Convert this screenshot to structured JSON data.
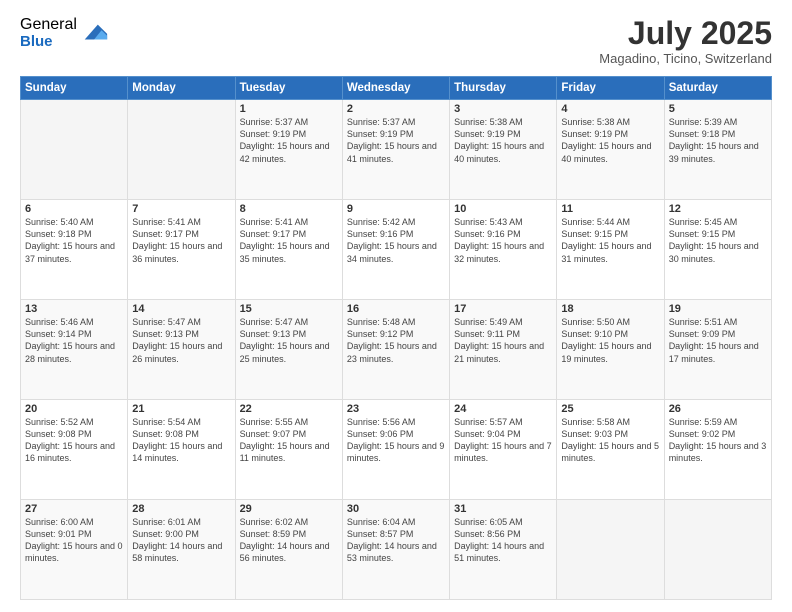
{
  "logo": {
    "general": "General",
    "blue": "Blue"
  },
  "title": "July 2025",
  "subtitle": "Magadino, Ticino, Switzerland",
  "days_of_week": [
    "Sunday",
    "Monday",
    "Tuesday",
    "Wednesday",
    "Thursday",
    "Friday",
    "Saturday"
  ],
  "weeks": [
    [
      {
        "day": "",
        "info": ""
      },
      {
        "day": "",
        "info": ""
      },
      {
        "day": "1",
        "info": "Sunrise: 5:37 AM\nSunset: 9:19 PM\nDaylight: 15 hours and 42 minutes."
      },
      {
        "day": "2",
        "info": "Sunrise: 5:37 AM\nSunset: 9:19 PM\nDaylight: 15 hours and 41 minutes."
      },
      {
        "day": "3",
        "info": "Sunrise: 5:38 AM\nSunset: 9:19 PM\nDaylight: 15 hours and 40 minutes."
      },
      {
        "day": "4",
        "info": "Sunrise: 5:38 AM\nSunset: 9:19 PM\nDaylight: 15 hours and 40 minutes."
      },
      {
        "day": "5",
        "info": "Sunrise: 5:39 AM\nSunset: 9:18 PM\nDaylight: 15 hours and 39 minutes."
      }
    ],
    [
      {
        "day": "6",
        "info": "Sunrise: 5:40 AM\nSunset: 9:18 PM\nDaylight: 15 hours and 37 minutes."
      },
      {
        "day": "7",
        "info": "Sunrise: 5:41 AM\nSunset: 9:17 PM\nDaylight: 15 hours and 36 minutes."
      },
      {
        "day": "8",
        "info": "Sunrise: 5:41 AM\nSunset: 9:17 PM\nDaylight: 15 hours and 35 minutes."
      },
      {
        "day": "9",
        "info": "Sunrise: 5:42 AM\nSunset: 9:16 PM\nDaylight: 15 hours and 34 minutes."
      },
      {
        "day": "10",
        "info": "Sunrise: 5:43 AM\nSunset: 9:16 PM\nDaylight: 15 hours and 32 minutes."
      },
      {
        "day": "11",
        "info": "Sunrise: 5:44 AM\nSunset: 9:15 PM\nDaylight: 15 hours and 31 minutes."
      },
      {
        "day": "12",
        "info": "Sunrise: 5:45 AM\nSunset: 9:15 PM\nDaylight: 15 hours and 30 minutes."
      }
    ],
    [
      {
        "day": "13",
        "info": "Sunrise: 5:46 AM\nSunset: 9:14 PM\nDaylight: 15 hours and 28 minutes."
      },
      {
        "day": "14",
        "info": "Sunrise: 5:47 AM\nSunset: 9:13 PM\nDaylight: 15 hours and 26 minutes."
      },
      {
        "day": "15",
        "info": "Sunrise: 5:47 AM\nSunset: 9:13 PM\nDaylight: 15 hours and 25 minutes."
      },
      {
        "day": "16",
        "info": "Sunrise: 5:48 AM\nSunset: 9:12 PM\nDaylight: 15 hours and 23 minutes."
      },
      {
        "day": "17",
        "info": "Sunrise: 5:49 AM\nSunset: 9:11 PM\nDaylight: 15 hours and 21 minutes."
      },
      {
        "day": "18",
        "info": "Sunrise: 5:50 AM\nSunset: 9:10 PM\nDaylight: 15 hours and 19 minutes."
      },
      {
        "day": "19",
        "info": "Sunrise: 5:51 AM\nSunset: 9:09 PM\nDaylight: 15 hours and 17 minutes."
      }
    ],
    [
      {
        "day": "20",
        "info": "Sunrise: 5:52 AM\nSunset: 9:08 PM\nDaylight: 15 hours and 16 minutes."
      },
      {
        "day": "21",
        "info": "Sunrise: 5:54 AM\nSunset: 9:08 PM\nDaylight: 15 hours and 14 minutes."
      },
      {
        "day": "22",
        "info": "Sunrise: 5:55 AM\nSunset: 9:07 PM\nDaylight: 15 hours and 11 minutes."
      },
      {
        "day": "23",
        "info": "Sunrise: 5:56 AM\nSunset: 9:06 PM\nDaylight: 15 hours and 9 minutes."
      },
      {
        "day": "24",
        "info": "Sunrise: 5:57 AM\nSunset: 9:04 PM\nDaylight: 15 hours and 7 minutes."
      },
      {
        "day": "25",
        "info": "Sunrise: 5:58 AM\nSunset: 9:03 PM\nDaylight: 15 hours and 5 minutes."
      },
      {
        "day": "26",
        "info": "Sunrise: 5:59 AM\nSunset: 9:02 PM\nDaylight: 15 hours and 3 minutes."
      }
    ],
    [
      {
        "day": "27",
        "info": "Sunrise: 6:00 AM\nSunset: 9:01 PM\nDaylight: 15 hours and 0 minutes."
      },
      {
        "day": "28",
        "info": "Sunrise: 6:01 AM\nSunset: 9:00 PM\nDaylight: 14 hours and 58 minutes."
      },
      {
        "day": "29",
        "info": "Sunrise: 6:02 AM\nSunset: 8:59 PM\nDaylight: 14 hours and 56 minutes."
      },
      {
        "day": "30",
        "info": "Sunrise: 6:04 AM\nSunset: 8:57 PM\nDaylight: 14 hours and 53 minutes."
      },
      {
        "day": "31",
        "info": "Sunrise: 6:05 AM\nSunset: 8:56 PM\nDaylight: 14 hours and 51 minutes."
      },
      {
        "day": "",
        "info": ""
      },
      {
        "day": "",
        "info": ""
      }
    ]
  ]
}
